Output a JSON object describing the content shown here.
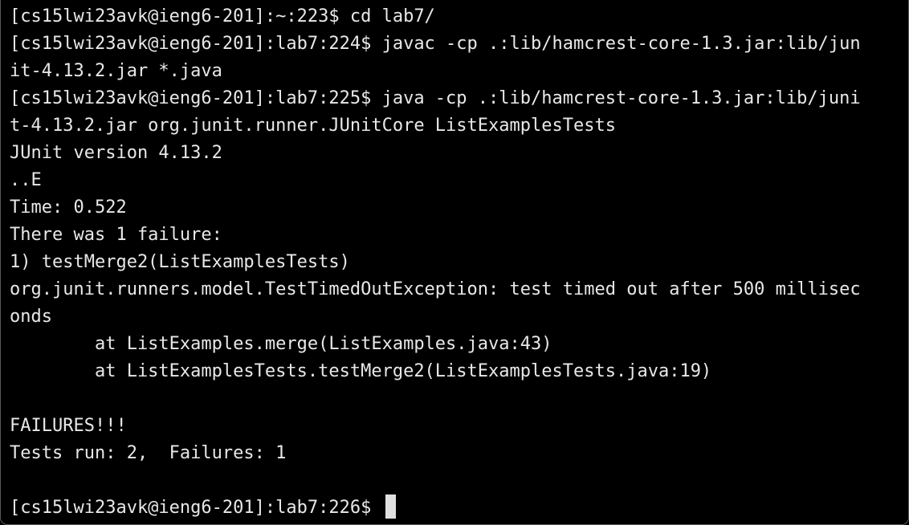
{
  "terminal": {
    "lines": [
      "[cs15lwi23avk@ieng6-201]:~:223$ cd lab7/",
      "[cs15lwi23avk@ieng6-201]:lab7:224$ javac -cp .:lib/hamcrest-core-1.3.jar:lib/jun",
      "it-4.13.2.jar *.java",
      "[cs15lwi23avk@ieng6-201]:lab7:225$ java -cp .:lib/hamcrest-core-1.3.jar:lib/juni",
      "t-4.13.2.jar org.junit.runner.JUnitCore ListExamplesTests",
      "JUnit version 4.13.2",
      "..E",
      "Time: 0.522",
      "There was 1 failure:",
      "1) testMerge2(ListExamplesTests)",
      "org.junit.runners.model.TestTimedOutException: test timed out after 500 millisec",
      "onds",
      "        at ListExamples.merge(ListExamples.java:43)",
      "        at ListExamplesTests.testMerge2(ListExamplesTests.java:19)",
      "",
      "FAILURES!!!",
      "Tests run: 2,  Failures: 1",
      ""
    ],
    "prompt": "[cs15lwi23avk@ieng6-201]:lab7:226$ "
  },
  "colors": {
    "background": "#000000",
    "foreground": "#e8e8e8",
    "cursor": "#e0e0e0"
  }
}
